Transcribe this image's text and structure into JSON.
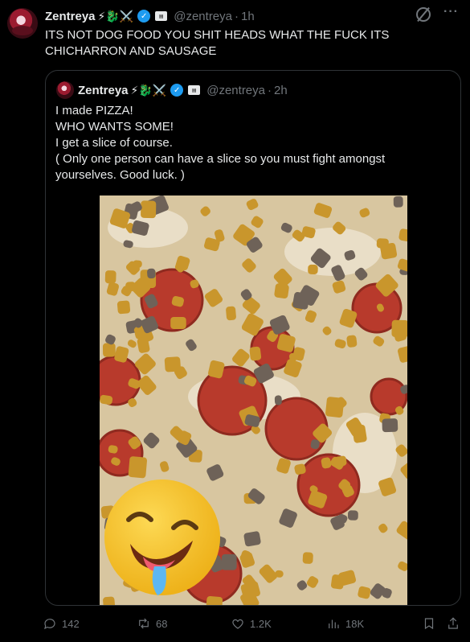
{
  "post": {
    "author_name": "Zentreya",
    "author_emojis": "⚡🐉⚔️",
    "handle": "@zentreya",
    "separator": "·",
    "time": "1h",
    "text": "ITS NOT DOG FOOD YOU SHIT HEADS WHAT THE FUCK ITS CHICHARRON AND SAUSAGE"
  },
  "quoted_post": {
    "author_name": "Zentreya",
    "author_emojis": "⚡🐉⚔️",
    "handle": "@zentreya",
    "separator": "·",
    "time": "2h",
    "lines": [
      "I made PIZZA!",
      "WHO WANTS SOME!",
      "I get a slice of course.",
      "( Only one person can have a slice so you must fight amongst yourselves. Good luck. )"
    ]
  },
  "actions": {
    "replies": "142",
    "reposts": "68",
    "likes": "1.2K",
    "views": "18K"
  },
  "icons": {
    "verified": "verified-badge-icon",
    "affiliate": "affiliate-badge-icon",
    "grok": "grok-icon",
    "more": "more-icon",
    "reply": "reply-icon",
    "repost": "repost-icon",
    "like": "like-icon",
    "views": "views-icon",
    "bookmark": "bookmark-icon",
    "share": "share-icon"
  },
  "colors": {
    "background": "#000000",
    "text": "#e7e9ea",
    "muted": "#71767b",
    "verified": "#1d9bf0",
    "border": "#2f3336"
  }
}
